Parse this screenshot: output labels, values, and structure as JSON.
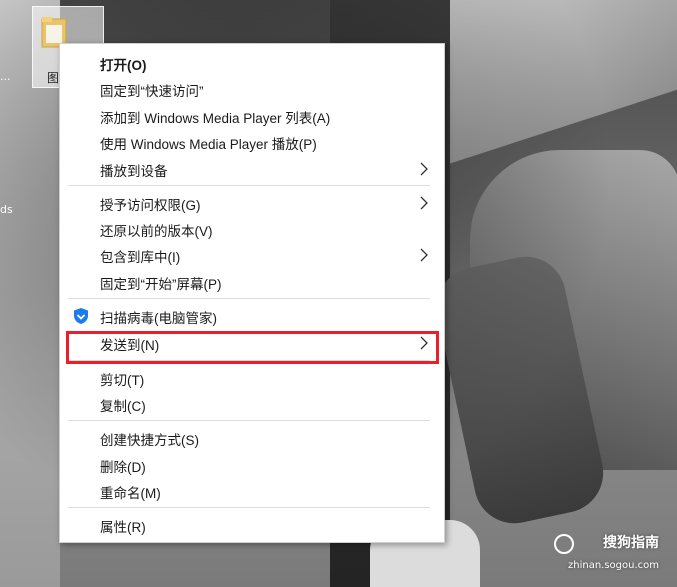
{
  "desktop": {
    "icon_label": "图",
    "edge_text_1": "...",
    "edge_text_2": "ds"
  },
  "context_menu": {
    "items": [
      {
        "label": "打开(O)"
      },
      {
        "label": "固定到“快速访问”"
      },
      {
        "label": "添加到 Windows Media Player 列表(A)"
      },
      {
        "label": "使用 Windows Media Player 播放(P)"
      },
      {
        "label": "播放到设备",
        "submenu": true
      },
      {
        "label": "授予访问权限(G)",
        "submenu": true
      },
      {
        "label": "还原以前的版本(V)"
      },
      {
        "label": "包含到库中(I)",
        "submenu": true
      },
      {
        "label": "固定到“开始”屏幕(P)"
      },
      {
        "label": "扫描病毒(电脑管家)",
        "icon": "tencent-pc-manager-shield-icon"
      },
      {
        "label": "发送到(N)",
        "submenu": true,
        "highlighted": true
      },
      {
        "label": "剪切(T)"
      },
      {
        "label": "复制(C)"
      },
      {
        "label": "创建快捷方式(S)"
      },
      {
        "label": "删除(D)"
      },
      {
        "label": "重命名(M)"
      },
      {
        "label": "属性(R)"
      }
    ]
  },
  "annotation": {
    "highlight_color": "#e8202a"
  },
  "watermark": {
    "brand": "搜狗指南",
    "url": "zhinan.sogou.com"
  }
}
